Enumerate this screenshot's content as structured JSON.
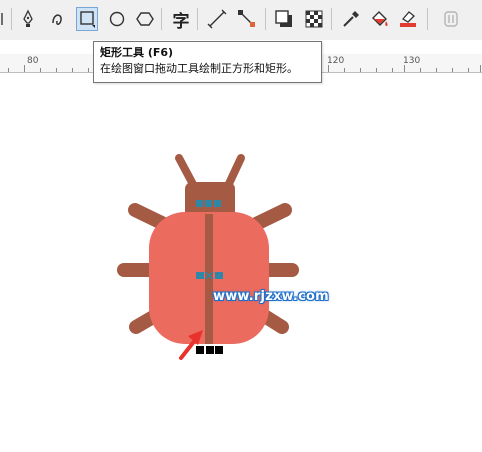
{
  "toolbar": {
    "text_tool_glyph": "字",
    "tools": [
      {
        "name": "pen-tool-icon"
      },
      {
        "name": "b-spline-tool-icon"
      },
      {
        "name": "rectangle-tool-icon",
        "active": true
      },
      {
        "name": "ellipse-tool-icon"
      },
      {
        "name": "polygon-tool-icon"
      },
      {
        "name": "text-tool-icon"
      },
      {
        "name": "parallel-dimension-tool-icon"
      },
      {
        "name": "connector-tool-icon"
      },
      {
        "name": "drop-shadow-tool-icon"
      },
      {
        "name": "transparency-tool-icon"
      },
      {
        "name": "eyedropper-tool-icon"
      },
      {
        "name": "interactive-fill-tool-icon"
      },
      {
        "name": "smart-fill-tool-icon"
      },
      {
        "name": "disabled-tool-icon"
      }
    ]
  },
  "tooltip": {
    "title": "矩形工具 (F6)",
    "description": "在绘图窗口拖动工具绘制正方形和矩形。"
  },
  "ruler": {
    "labels": [
      "80",
      "120",
      "130"
    ]
  },
  "watermark": {
    "text": "www.rjzxw.com"
  },
  "colors": {
    "body": "#ec6b5f",
    "head": "#a45a43",
    "legs": "#a45a43",
    "spots": "#2f86a6",
    "arrow": "#e8322b",
    "watermark_outline": "#1f6fc9",
    "active_tool": "#cfe3f7"
  }
}
